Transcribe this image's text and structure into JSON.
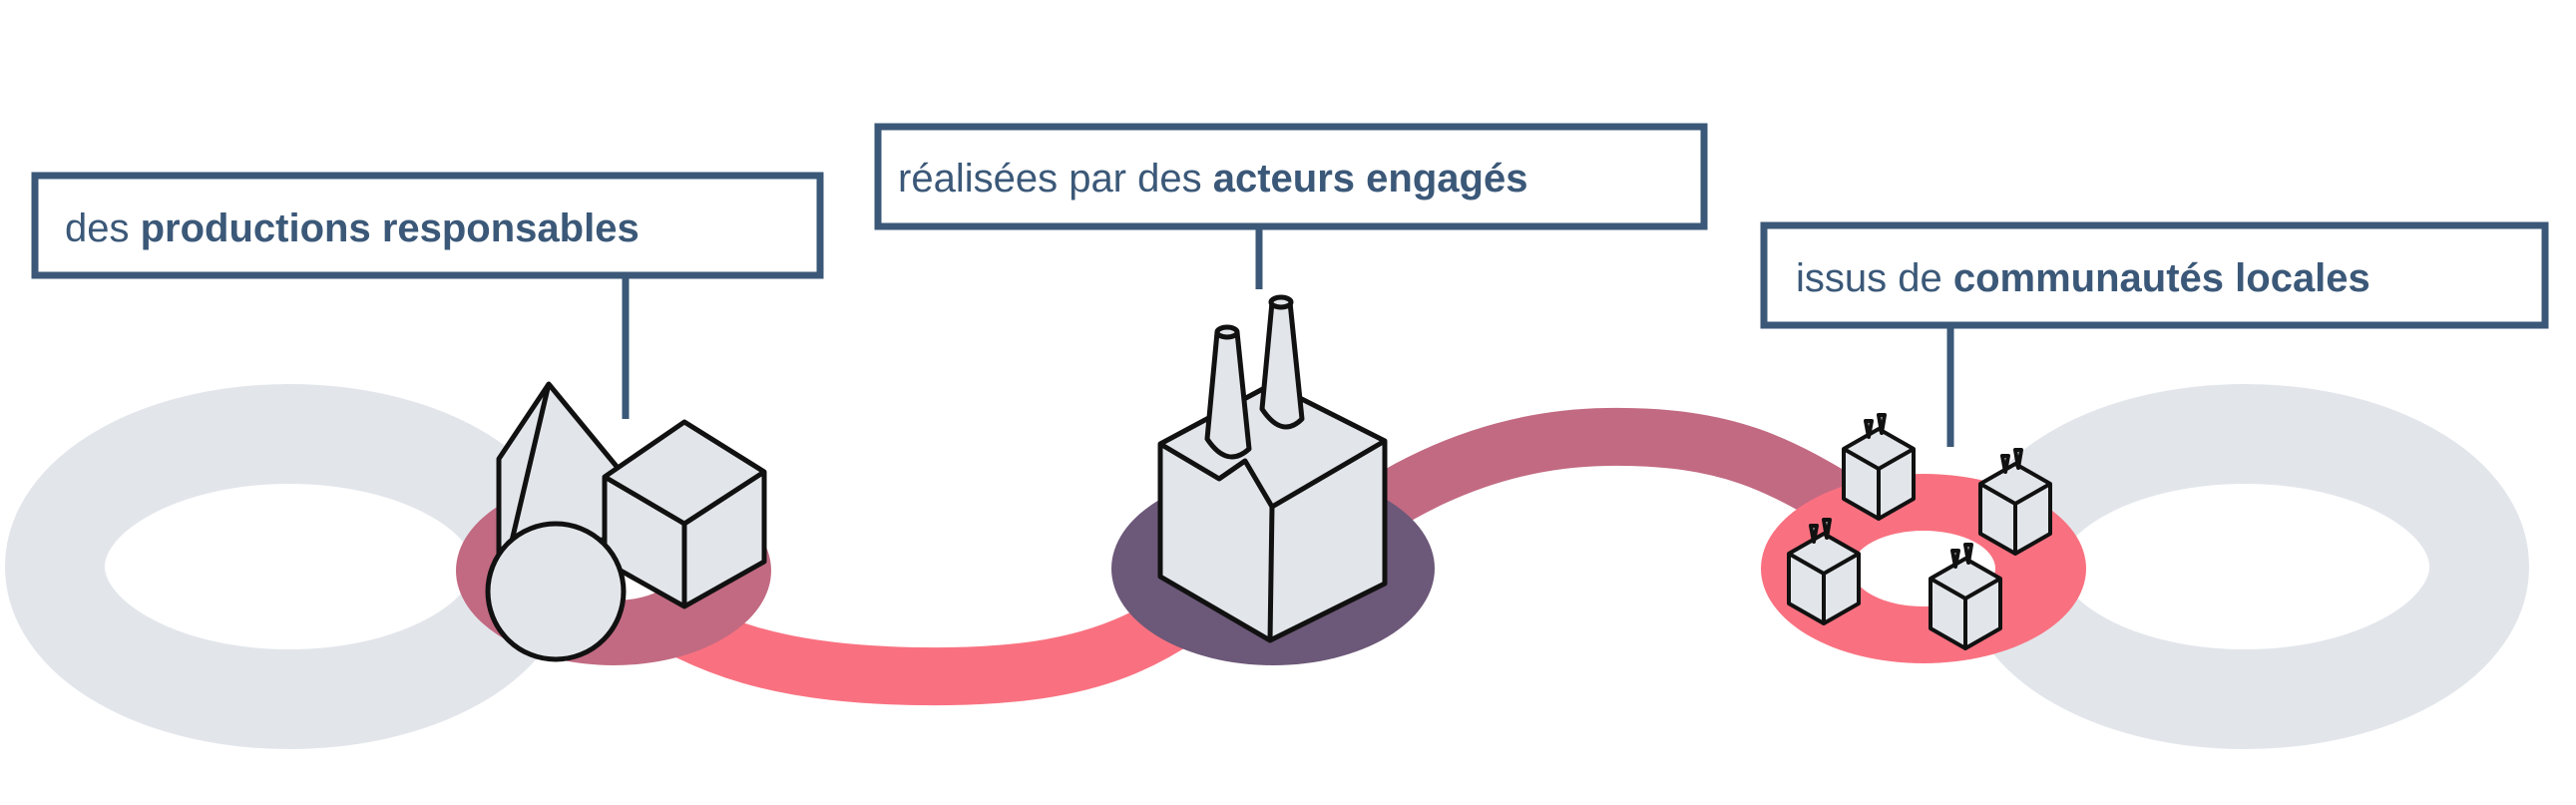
{
  "labels": {
    "left": {
      "prefix": "des ",
      "emphasis": "productions responsables"
    },
    "center": {
      "prefix": "réalisées par des ",
      "emphasis": "acteurs engagés"
    },
    "right": {
      "prefix": "issus de ",
      "emphasis": "communautés locales"
    }
  },
  "colors": {
    "label_navy": "#3b5878",
    "loop_gray": "#e2e6eb",
    "path_mauve": "#c26a82",
    "path_coral": "#f97180",
    "disc_purple": "#6c5878",
    "shape_fill": "#e2e6ea",
    "outline": "#111111",
    "background": "#ffffff"
  },
  "icons": [
    "geometric-shapes-icon",
    "factory-icon",
    "small-factories-icon"
  ]
}
